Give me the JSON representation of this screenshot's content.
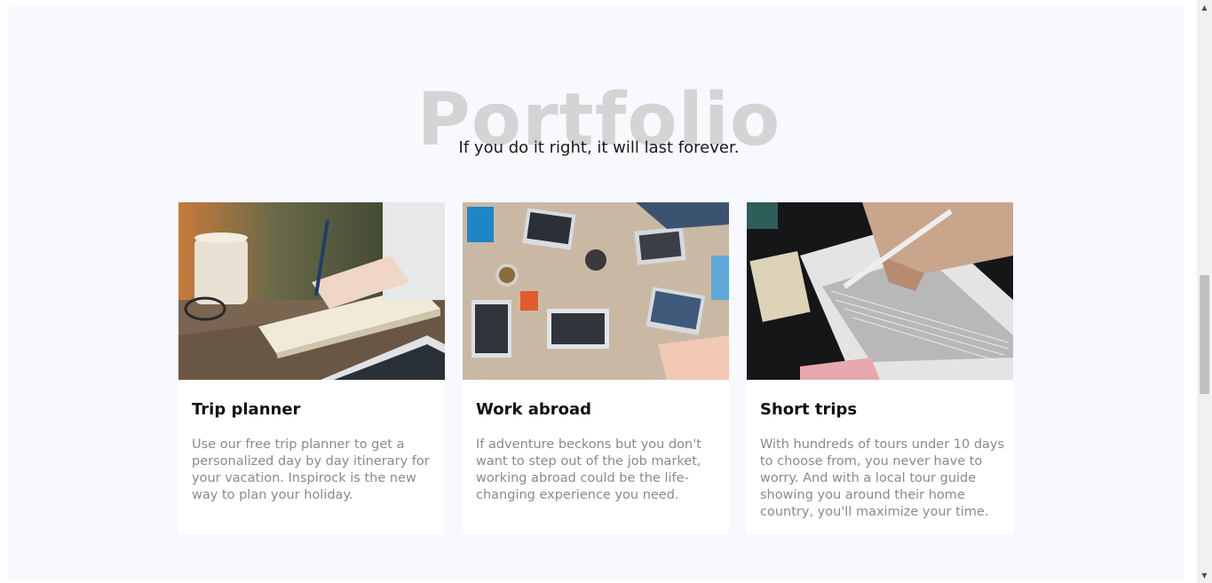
{
  "portfolio": {
    "heading": "Portfolio",
    "tagline": "If you do it right, it will last forever."
  },
  "cards": [
    {
      "title": "Trip planner",
      "text": "Use our free trip planner to get a personalized day by day itinerary for your vacation. Inspirock is the new way to plan your holiday."
    },
    {
      "title": "Work abroad",
      "text": "If adventure beckons but you don't want to step out of the job market, working abroad could be the life-changing experience you need."
    },
    {
      "title": "Short trips",
      "text": "With hundreds of tours under 10 days to choose from, you never have to worry. And with a local tour guide showing you around their home country, you'll maximize your time."
    }
  ],
  "scrollbar": {
    "up_arrow": "▲",
    "down_arrow": "▼"
  }
}
